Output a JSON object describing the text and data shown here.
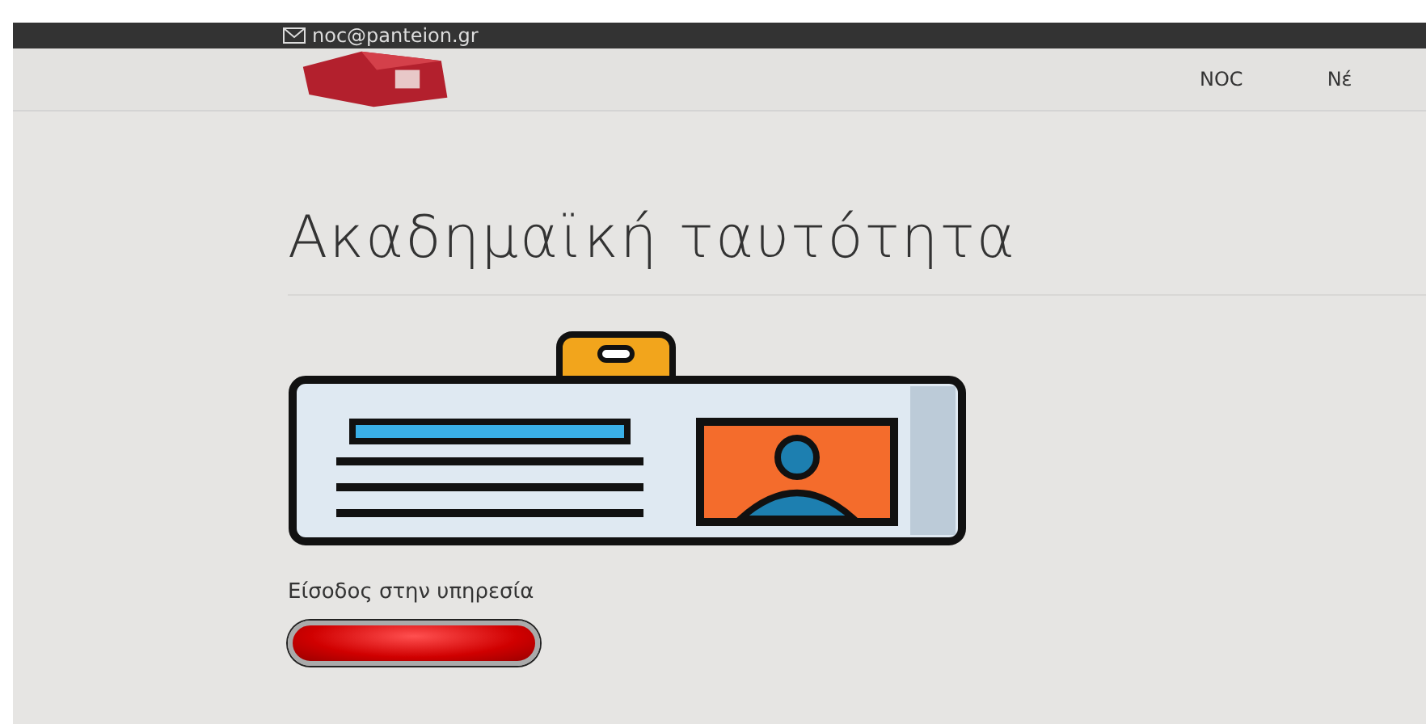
{
  "topbar": {
    "email": "noc@panteion.gr"
  },
  "nav": {
    "items": [
      {
        "label": "NOC"
      },
      {
        "label": "Νέ"
      }
    ]
  },
  "page": {
    "title": "Ακαδημαϊκή ταυτότητα",
    "service_label": "Είσοδος στην υπηρεσία"
  }
}
